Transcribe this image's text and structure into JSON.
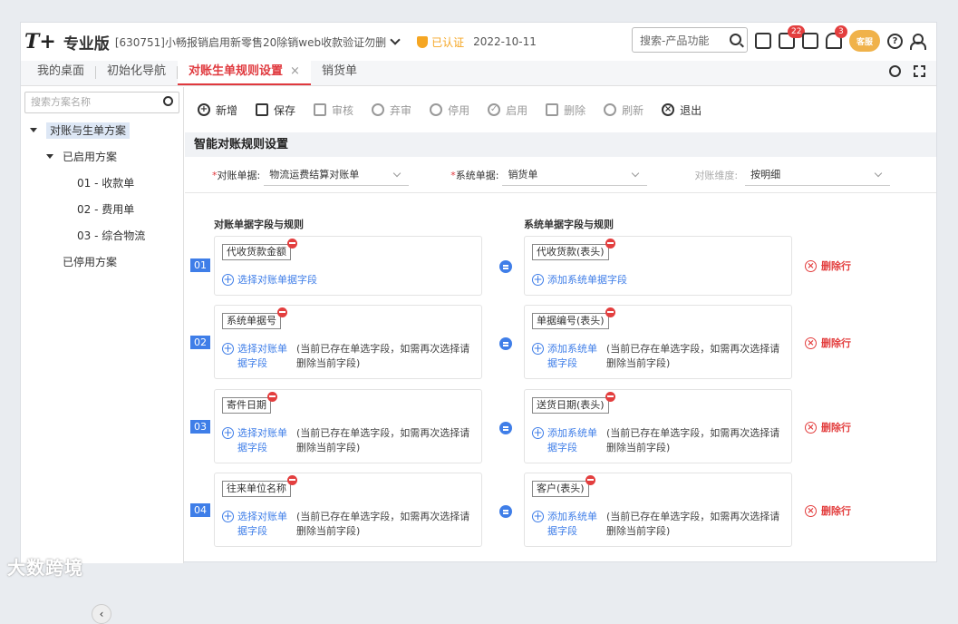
{
  "header": {
    "logo": "T+",
    "edition": "专业版",
    "company": "[630751]小畅报销启用新零售20除销web收款验证勿删",
    "certified": "已认证",
    "date": "2022-10-11",
    "search_placeholder": "搜索-产品功能",
    "todo_badge": "22",
    "message_badge": "3",
    "service_label": "客服"
  },
  "tabs": [
    {
      "label": "我的桌面"
    },
    {
      "label": "初始化导航"
    },
    {
      "label": "对账生单规则设置",
      "close": "×"
    },
    {
      "label": "销货单"
    }
  ],
  "sidebar": {
    "search_placeholder": "搜索方案名称",
    "root": "对账与生单方案",
    "enabled_group": "已启用方案",
    "items": [
      "01 - 收款单",
      "02 - 费用单",
      "03 - 综合物流"
    ],
    "disabled_group": "已停用方案"
  },
  "toolbar": {
    "new": "新增",
    "save": "保存",
    "audit": "审核",
    "unaudit": "弃审",
    "disable": "停用",
    "enable": "启用",
    "delete": "删除",
    "refresh": "刷新",
    "exit": "退出"
  },
  "section_title": "智能对账规则设置",
  "filters": {
    "recon_doc_label": "对账单据:",
    "recon_doc_value": "物流运费结算对账单",
    "system_doc_label": "系统单据:",
    "system_doc_value": "销货单",
    "dimension_label": "对账维度:",
    "dimension_value": "按明细"
  },
  "columns": {
    "left": "对账单据字段与规则",
    "right": "系统单据字段与规则"
  },
  "rules": [
    {
      "num": "01",
      "left_field": "代收货款金额",
      "right_field": "代收货款(表头)",
      "left_add": "选择对账单据字段",
      "right_add": "添加系统单据字段",
      "hint": "",
      "delete": "删除行"
    },
    {
      "num": "02",
      "left_field": "系统单据号",
      "right_field": "单据编号(表头)",
      "left_add": "选择对账单据字段",
      "right_add": "添加系统单据字段",
      "hint": "(当前已存在单选字段，如需再次选择请删除当前字段)",
      "delete": "删除行"
    },
    {
      "num": "03",
      "left_field": "寄件日期",
      "right_field": "送货日期(表头)",
      "left_add": "选择对账单据字段",
      "right_add": "添加系统单据字段",
      "hint": "(当前已存在单选字段，如需再次选择请删除当前字段)",
      "delete": "删除行"
    },
    {
      "num": "04",
      "left_field": "往来单位名称",
      "right_field": "客户(表头)",
      "left_add": "选择对账单据字段",
      "right_add": "添加系统单据字段",
      "hint": "(当前已存在单选字段，如需再次选择请删除当前字段)",
      "delete": "删除行"
    }
  ],
  "watermark": "大数跨境"
}
